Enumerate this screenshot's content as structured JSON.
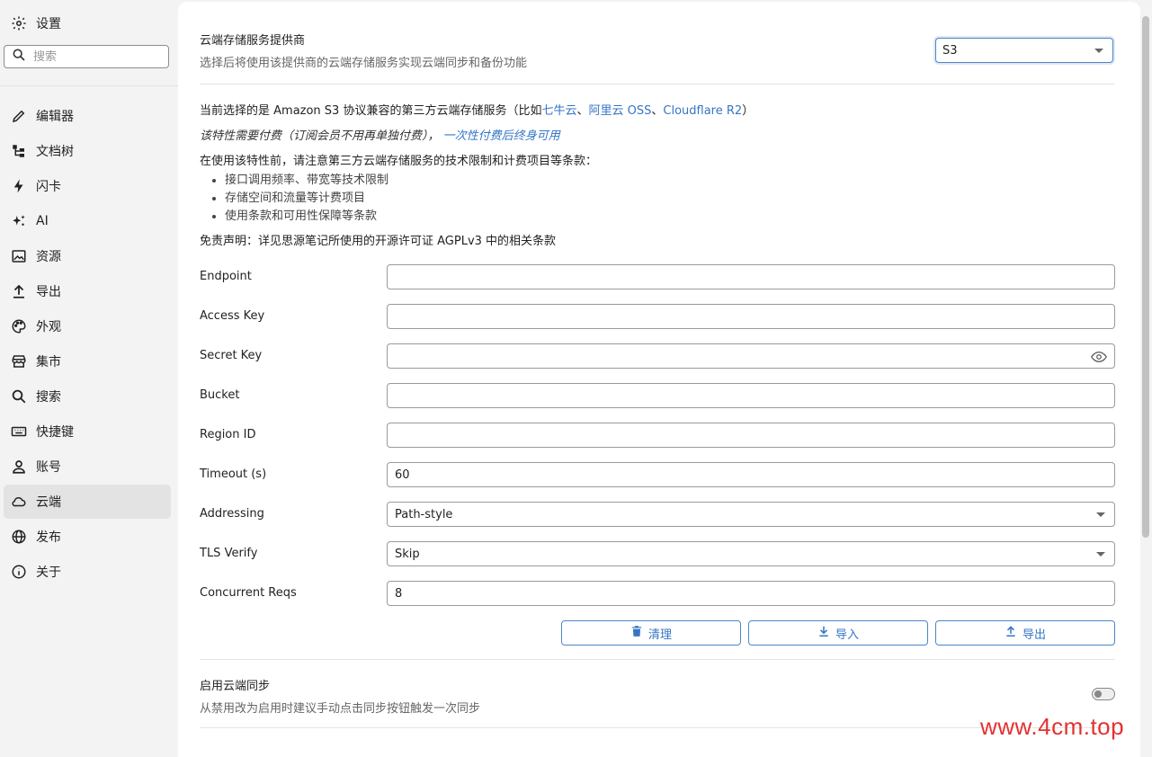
{
  "sidebar": {
    "title": "设置",
    "search_placeholder": "搜索",
    "items": [
      {
        "label": "编辑器",
        "icon": "pencil-icon"
      },
      {
        "label": "文档树",
        "icon": "tree-icon"
      },
      {
        "label": "闪卡",
        "icon": "lightning-icon"
      },
      {
        "label": "AI",
        "icon": "sparkle-icon"
      },
      {
        "label": "资源",
        "icon": "image-icon"
      },
      {
        "label": "导出",
        "icon": "upload-icon"
      },
      {
        "label": "外观",
        "icon": "palette-icon"
      },
      {
        "label": "集市",
        "icon": "store-icon"
      },
      {
        "label": "搜索",
        "icon": "search-icon"
      },
      {
        "label": "快捷键",
        "icon": "keyboard-icon"
      },
      {
        "label": "账号",
        "icon": "user-icon"
      },
      {
        "label": "云端",
        "icon": "cloud-icon"
      },
      {
        "label": "发布",
        "icon": "globe-icon"
      },
      {
        "label": "关于",
        "icon": "info-icon"
      }
    ],
    "active_item": "云端"
  },
  "provider": {
    "title": "云端存储服务提供商",
    "desc": "选择后将使用该提供商的云端存储服务实现云端同步和备份功能",
    "selected": "S3"
  },
  "info": {
    "current_prefix": "当前选择的是 Amazon S3 协议兼容的第三方云端存储服务（比如",
    "link1": "七牛云",
    "sep1": "、",
    "link2": "阿里云 OSS",
    "sep2": "、",
    "link3": "Cloudflare R2",
    "current_suffix": "）",
    "pay_text": "该特性需要付费（订阅会员不用再单独付费），",
    "pay_link": "一次性付费后终身可用",
    "notice": "在使用该特性前，请注意第三方云端存储服务的技术限制和计费项目等条款：",
    "bullets": [
      "接口调用频率、带宽等技术限制",
      "存储空间和流量等计费项目",
      "使用条款和可用性保障等条款"
    ],
    "disclaimer": "免责声明：详见思源笔记所使用的开源许可证 AGPLv3 中的相关条款"
  },
  "fields": {
    "endpoint": {
      "label": "Endpoint",
      "value": ""
    },
    "access_key": {
      "label": "Access Key",
      "value": ""
    },
    "secret_key": {
      "label": "Secret Key",
      "value": ""
    },
    "bucket": {
      "label": "Bucket",
      "value": ""
    },
    "region": {
      "label": "Region ID",
      "value": ""
    },
    "timeout": {
      "label": "Timeout (s)",
      "value": "60"
    },
    "addressing": {
      "label": "Addressing",
      "value": "Path-style"
    },
    "tls": {
      "label": "TLS Verify",
      "value": "Skip"
    },
    "concurrent": {
      "label": "Concurrent Reqs",
      "value": "8"
    }
  },
  "buttons": {
    "purge": "清理",
    "import": "导入",
    "export": "导出"
  },
  "sync": {
    "title": "启用云端同步",
    "desc": "从禁用改为启用时建议手动点击同步按钮触发一次同步",
    "enabled": false
  },
  "watermark": "www.4cm.top",
  "colors": {
    "accent": "#3575c5",
    "active_bg": "#e3e3e3",
    "watermark": "#e53030"
  }
}
